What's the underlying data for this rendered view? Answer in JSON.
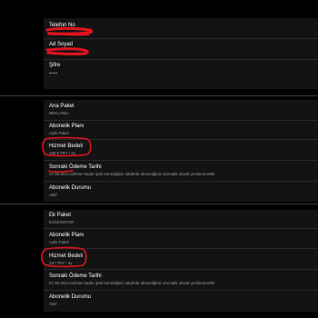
{
  "account": {
    "phone_label": "Telefon No",
    "name_label": "Ad Soyad",
    "password_label": "Şifre",
    "password_value": "••••••"
  },
  "package_main": {
    "title": "Ana Paket",
    "subtitle": "REKLAMLI",
    "plan_label": "Abonelik Planı",
    "plan_value": "Aylık Paket",
    "fee_label": "Hizmet Bedeli",
    "fee_value": "169,9 TRY / ay",
    "next_label": "Sonraki Ödeme Tarihi",
    "next_value": "07.05.2024 tarihine kadar iptal etmediğiniz takdirde aboneliğiniz otomatik olarak yenilenecektir",
    "status_label": "Abonelik Durumu",
    "status_value": "Aktif"
  },
  "package_extra": {
    "title": "Ek Paket",
    "subtitle": "EXXENSPOR",
    "plan_label": "Abonelik Planı",
    "plan_value": "Aylık Paket",
    "fee_label": "Hizmet Bedeli",
    "fee_value": "167 TRY / ay",
    "next_label": "Sonraki Ödeme Tarihi",
    "next_value": "07.05.2024 tarihine kadar iptal etmediğiniz takdirde aboneliğiniz otomatik olarak yenilenecektir",
    "status_label": "Abonelik Durumu",
    "status_value": "Aktif"
  },
  "colors": {
    "background": "#000000",
    "panel": "#131313",
    "annotation": "#e0141e"
  }
}
